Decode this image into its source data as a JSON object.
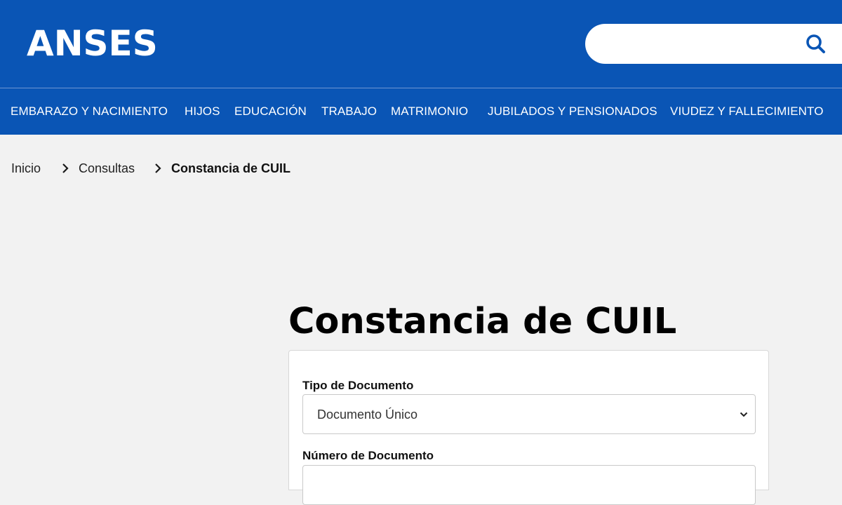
{
  "header": {
    "logo_text": "ANSES",
    "brand_color": "#0a55b5",
    "search": {
      "value": "",
      "placeholder": "",
      "icon": "search-icon"
    }
  },
  "nav": {
    "items": [
      {
        "label": "EMBARAZO Y NACIMIENTO"
      },
      {
        "label": "HIJOS"
      },
      {
        "label": "EDUCACIÓN"
      },
      {
        "label": "TRABAJO"
      },
      {
        "label": "MATRIMONIO"
      },
      {
        "label": "JUBILADOS Y PENSIONADOS"
      },
      {
        "label": "VIUDEZ Y FALLECIMIENTO"
      }
    ]
  },
  "breadcrumb": {
    "items": [
      {
        "label": "Inicio"
      },
      {
        "label": "Consultas"
      },
      {
        "label": "Constancia de CUIL"
      }
    ],
    "separator_icon": "chevron-right-icon"
  },
  "main": {
    "title": "Constancia de CUIL",
    "form": {
      "tipo_documento": {
        "label": "Tipo de Documento",
        "selected": "Documento Único"
      },
      "numero_documento": {
        "label": "Número de Documento",
        "value": ""
      }
    }
  }
}
